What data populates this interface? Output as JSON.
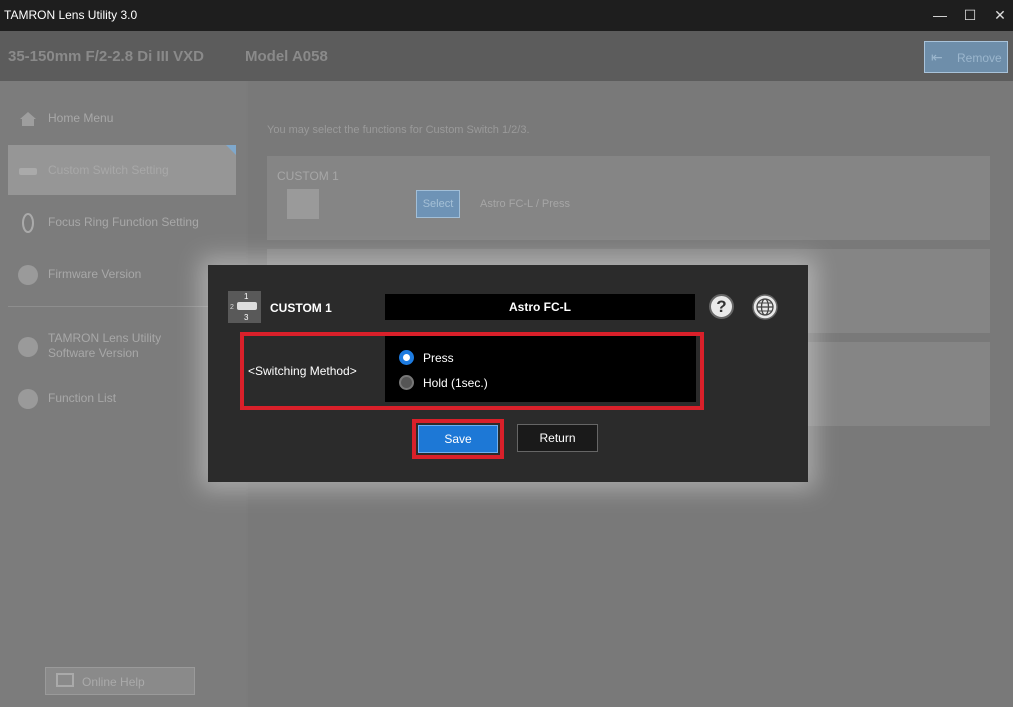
{
  "window": {
    "title": "TAMRON Lens Utility 3.0",
    "minimize": "—",
    "maximize": "☐",
    "close": "✕"
  },
  "header": {
    "lens_name": "35-150mm F/2-2.8 Di III VXD",
    "model": "Model A058",
    "remove_label": "Remove"
  },
  "sidebar": {
    "items": [
      {
        "label": "Home Menu"
      },
      {
        "label": "Custom Switch Setting"
      },
      {
        "label": "Focus Ring Function Setting"
      },
      {
        "label": "Firmware Version"
      },
      {
        "label": "TAMRON Lens Utility\nSoftware Version"
      },
      {
        "label": "Function List"
      }
    ],
    "online_help": "Online Help"
  },
  "main": {
    "intro": "You may select the functions for Custom Switch 1/2/3.",
    "panel1": {
      "title": "CUSTOM 1",
      "select_label": "Select",
      "value": "Astro FC-L  / Press"
    }
  },
  "dialog": {
    "icon_numbers": [
      "1",
      "2",
      "3"
    ],
    "custom_label": "CUSTOM 1",
    "function_value": "Astro FC-L",
    "help_glyph": "?",
    "switching_method_label": "<Switching Method>",
    "options": [
      {
        "label": "Press",
        "selected": true
      },
      {
        "label": "Hold (1sec.)",
        "selected": false
      }
    ],
    "save_label": "Save",
    "return_label": "Return"
  },
  "colors": {
    "accent": "#1d78d6",
    "highlight": "#d9202a"
  }
}
